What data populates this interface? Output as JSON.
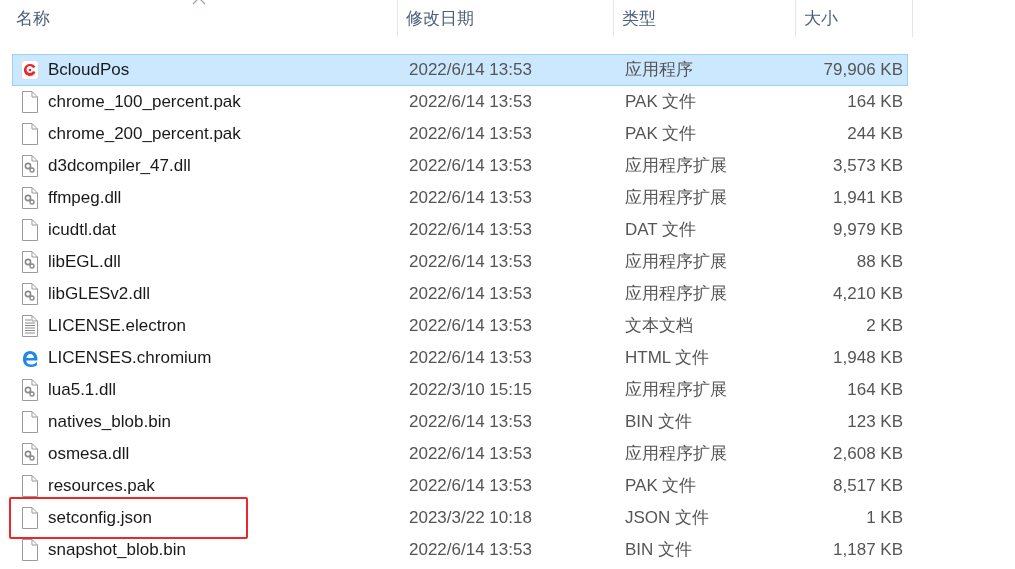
{
  "columns": [
    {
      "label": "名称",
      "sorted": true
    },
    {
      "label": "修改日期",
      "sorted": false
    },
    {
      "label": "类型",
      "sorted": false
    },
    {
      "label": "大小",
      "sorted": false
    }
  ],
  "files": [
    {
      "name": "BcloudPos",
      "date": "2022/6/14 13:53",
      "type": "应用程序",
      "size": "79,906 KB",
      "kind": "app",
      "selected": true,
      "highlighted": false
    },
    {
      "name": "chrome_100_percent.pak",
      "date": "2022/6/14 13:53",
      "type": "PAK 文件",
      "size": "164 KB",
      "kind": "file",
      "selected": false,
      "highlighted": false
    },
    {
      "name": "chrome_200_percent.pak",
      "date": "2022/6/14 13:53",
      "type": "PAK 文件",
      "size": "244 KB",
      "kind": "file",
      "selected": false,
      "highlighted": false
    },
    {
      "name": "d3dcompiler_47.dll",
      "date": "2022/6/14 13:53",
      "type": "应用程序扩展",
      "size": "3,573 KB",
      "kind": "dll",
      "selected": false,
      "highlighted": false
    },
    {
      "name": "ffmpeg.dll",
      "date": "2022/6/14 13:53",
      "type": "应用程序扩展",
      "size": "1,941 KB",
      "kind": "dll",
      "selected": false,
      "highlighted": false
    },
    {
      "name": "icudtl.dat",
      "date": "2022/6/14 13:53",
      "type": "DAT 文件",
      "size": "9,979 KB",
      "kind": "file",
      "selected": false,
      "highlighted": false
    },
    {
      "name": "libEGL.dll",
      "date": "2022/6/14 13:53",
      "type": "应用程序扩展",
      "size": "88 KB",
      "kind": "dll",
      "selected": false,
      "highlighted": false
    },
    {
      "name": "libGLESv2.dll",
      "date": "2022/6/14 13:53",
      "type": "应用程序扩展",
      "size": "4,210 KB",
      "kind": "dll",
      "selected": false,
      "highlighted": false
    },
    {
      "name": "LICENSE.electron",
      "date": "2022/6/14 13:53",
      "type": "文本文档",
      "size": "2 KB",
      "kind": "text",
      "selected": false,
      "highlighted": false
    },
    {
      "name": "LICENSES.chromium",
      "date": "2022/6/14 13:53",
      "type": "HTML 文件",
      "size": "1,948 KB",
      "kind": "html",
      "selected": false,
      "highlighted": false
    },
    {
      "name": "lua5.1.dll",
      "date": "2022/3/10 15:15",
      "type": "应用程序扩展",
      "size": "164 KB",
      "kind": "dll",
      "selected": false,
      "highlighted": false
    },
    {
      "name": "natives_blob.bin",
      "date": "2022/6/14 13:53",
      "type": "BIN 文件",
      "size": "123 KB",
      "kind": "file",
      "selected": false,
      "highlighted": false
    },
    {
      "name": "osmesa.dll",
      "date": "2022/6/14 13:53",
      "type": "应用程序扩展",
      "size": "2,608 KB",
      "kind": "dll",
      "selected": false,
      "highlighted": false
    },
    {
      "name": "resources.pak",
      "date": "2022/6/14 13:53",
      "type": "PAK 文件",
      "size": "8,517 KB",
      "kind": "file",
      "selected": false,
      "highlighted": false
    },
    {
      "name": "setconfig.json",
      "date": "2023/3/22 10:18",
      "type": "JSON 文件",
      "size": "1 KB",
      "kind": "file",
      "selected": false,
      "highlighted": true
    },
    {
      "name": "snapshot_blob.bin",
      "date": "2022/6/14 13:53",
      "type": "BIN 文件",
      "size": "1,187 KB",
      "kind": "file",
      "selected": false,
      "highlighted": false
    }
  ]
}
